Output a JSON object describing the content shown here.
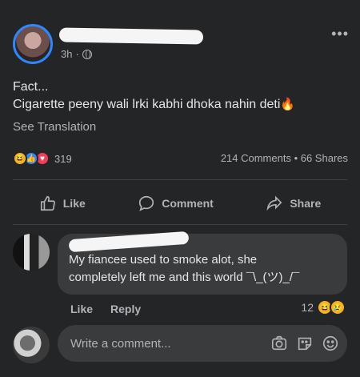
{
  "post": {
    "time": "3h",
    "dot": "·",
    "more": "•••",
    "text_line1": "Fact...",
    "text_line2": "Cigarette peeny wali lrki kabhi dhoka nahin deti",
    "emoji": "🔥",
    "see_translation": "See Translation",
    "reaction_count": "319",
    "counts": "214 Comments • 66 Shares"
  },
  "actions": {
    "like": "Like",
    "comment": "Comment",
    "share": "Share"
  },
  "comment": {
    "text_line1": "My fiancee used to smoke alot, she",
    "text_line2": "completely left me and this world ¯\\_(ツ)_/¯",
    "like": "Like",
    "reply": "Reply",
    "reaction_count": "12"
  },
  "composer": {
    "placeholder": "Write a comment..."
  },
  "colors": {
    "background": "#242526",
    "bubble": "#3a3b3c",
    "accent": "#2d88ff"
  }
}
